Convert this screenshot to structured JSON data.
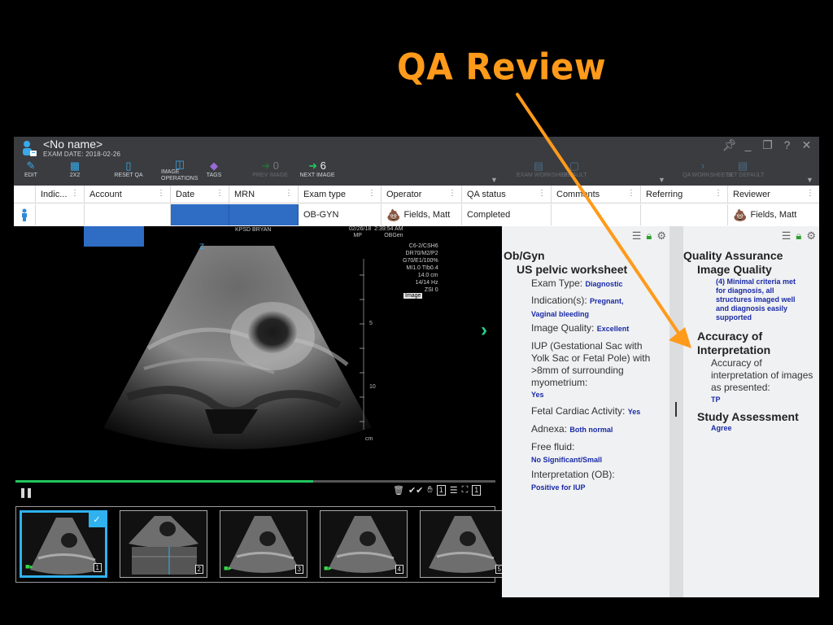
{
  "slide": {
    "title": "QA Review"
  },
  "window": {
    "patient_name": "<No name>",
    "exam_date": "EXAM DATE: 2018-02-26",
    "controls": [
      "pin",
      "minimize",
      "restore",
      "help",
      "close"
    ]
  },
  "toolbar": {
    "edit": "EDIT",
    "layout": "2X2",
    "reset_qa": "RESET QA",
    "image_ops_1": "IMAGE",
    "image_ops_2": "OPERATIONS",
    "tags": "TAGS",
    "prev_count": "0",
    "prev_image": "PREV IMAGE",
    "next_count": "6",
    "next_image": "NEXT IMAGE",
    "exam_worksheets": "EXAM WORKSHEETS",
    "exam_default": "DEFAULT",
    "qa_worksheets": "QA WORKSHEETS",
    "set_default": "SET DEFAULT"
  },
  "table": {
    "columns": [
      "Indic...",
      "Account",
      "Date",
      "MRN",
      "Exam type",
      "Operator",
      "QA status",
      "Comments",
      "Referring",
      "Reviewer"
    ],
    "row": {
      "exam_type": "OB-GYN",
      "operator": "Fields, Matt",
      "qa_status": "Completed",
      "reviewer": "Fields, Matt"
    }
  },
  "ultrasound": {
    "facility": "KPSD BRYAN",
    "date": "02/26/18",
    "time": "2:39:54 AM",
    "mode_top": "MP",
    "preset": "OBGen",
    "params": [
      "C6-2/CSH6",
      "DR70/M2/P2",
      "G70/E1/100%",
      "MI1.0  TIb0.4",
      "14.0 cm",
      "14/14 Hz",
      "ZSI 0"
    ],
    "image_label": "Image",
    "depth_labels": [
      "5",
      "10"
    ],
    "depth_unit": "cm",
    "progress": 0.62
  },
  "thumbnails": [
    {
      "num": "1",
      "selected": true,
      "video": true
    },
    {
      "num": "2",
      "selected": false,
      "video": false
    },
    {
      "num": "3",
      "selected": false,
      "video": true
    },
    {
      "num": "4",
      "selected": false,
      "video": true
    },
    {
      "num": "5",
      "selected": false,
      "video": false
    }
  ],
  "viewer_tools": {
    "layout_count": "1",
    "frame_count": "1"
  },
  "ob_worksheet": {
    "title": "Ob/Gyn",
    "subtitle": "US pelvic worksheet",
    "exam_type_q": "Exam Type:",
    "exam_type_a": "Diagnostic",
    "indication_q": "Indication(s):",
    "indication_a1": "Pregnant,",
    "indication_a2": "Vaginal bleeding",
    "image_quality_q": "Image Quality:",
    "image_quality_a": "Excellent",
    "iup_q1": "IUP (Gestational Sac with",
    "iup_q2": "Yolk Sac or Fetal Pole) with",
    "iup_q3": ">8mm of surrounding",
    "iup_q4": "myometrium:",
    "iup_a": "Yes",
    "fca_q": "Fetal Cardiac Activity:",
    "fca_a": "Yes",
    "adnexa_q": "Adnexa:",
    "adnexa_a": "Both normal",
    "fluid_q": "Free fluid:",
    "fluid_a": "No Significant/Small",
    "interp_q": "Interpretation (OB):",
    "interp_a": "Positive for IUP"
  },
  "qa_worksheet": {
    "title": "Quality Assurance",
    "iq_title": "Image Quality",
    "iq_a1": "(4) Minimal criteria met",
    "iq_a2": "for diagnosis, all",
    "iq_a3": "structures imaged well",
    "iq_a4": "and diagnosis easily",
    "iq_a5": "supported",
    "acc_title1": "Accuracy of",
    "acc_title2": "Interpretation",
    "acc_q1": "Accuracy of",
    "acc_q2": "interpretation of images",
    "acc_q3": "as presented:",
    "acc_a": "TP",
    "study_title": "Study Assessment",
    "study_a": "Agree"
  },
  "colors": {
    "annotation": "#ff9a1a",
    "accent": "#39a9e8",
    "answer": "#1a2aa6",
    "progress": "#22c55e",
    "redaction": "#2f6cc4"
  }
}
